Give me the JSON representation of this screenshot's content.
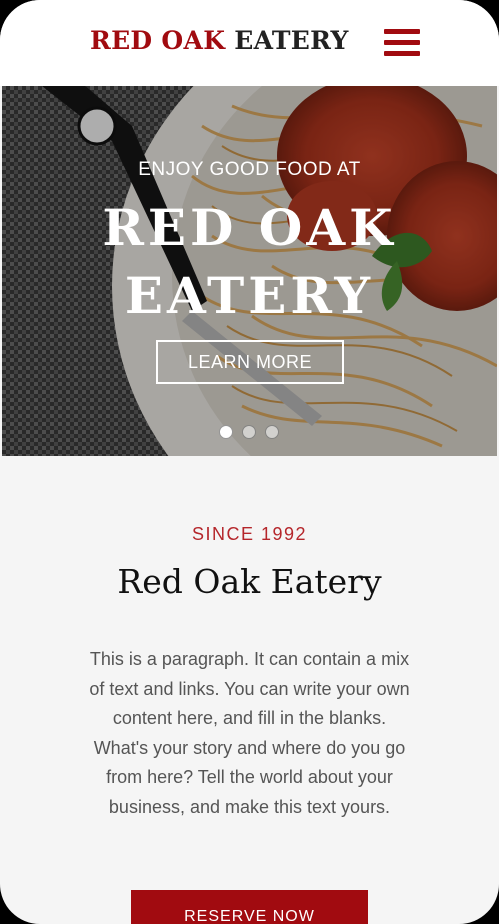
{
  "header": {
    "brand_part1": "RED OAK",
    "brand_part2": " EATERY",
    "menu_icon": "hamburger-menu-icon"
  },
  "hero": {
    "kicker": "ENJOY GOOD FOOD AT",
    "title": "RED OAK EATERY",
    "button_label": "LEARN MORE",
    "slides_total": 3,
    "active_slide": 1
  },
  "about": {
    "eyebrow": "SINCE 1992",
    "title": "Red Oak Eatery",
    "paragraph": "This is a paragraph. It can contain a mix of text and links. You can write your own content here, and fill in the blanks. What's your story and where do you go from here? Tell the world about your business, and make this text yours.",
    "button_label": "RESERVE NOW"
  },
  "colors": {
    "brand_red": "#a10b10",
    "eyebrow_red": "#b5262b",
    "header_bg": "#ffffff",
    "section_bg": "#f5f5f5",
    "text_dark": "#222222"
  }
}
